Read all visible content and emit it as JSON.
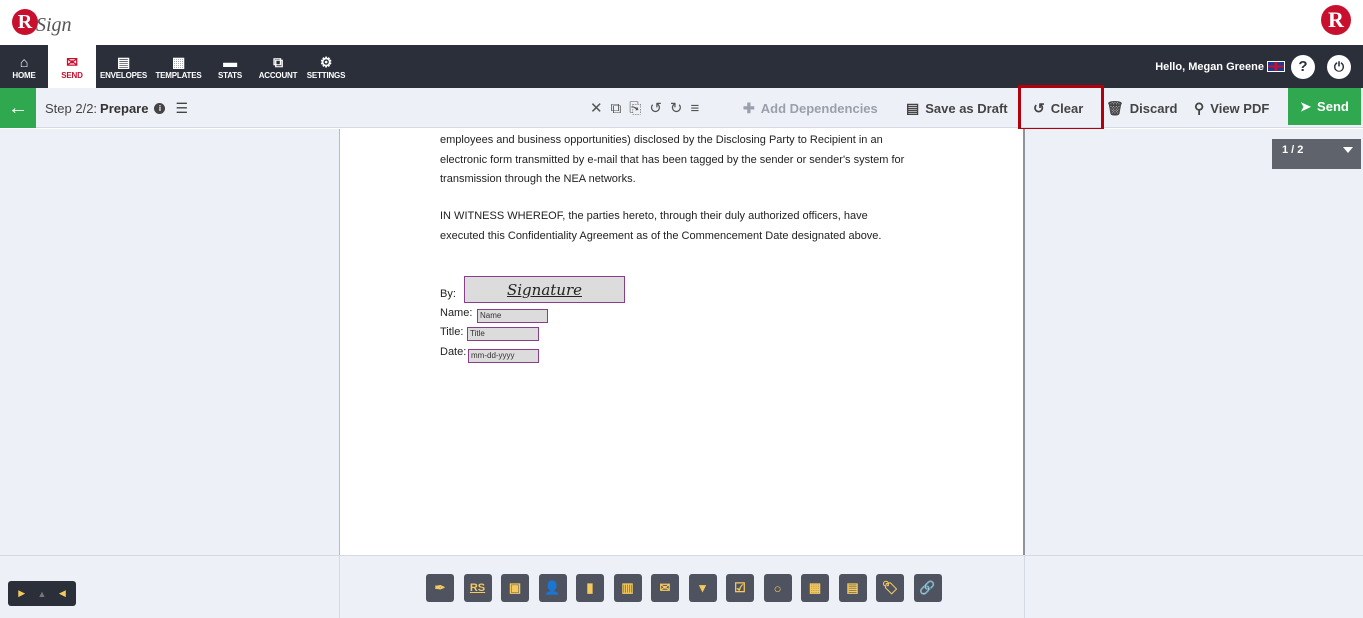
{
  "brand": {
    "logo_letter": "R",
    "logo_text": "Sign"
  },
  "nav": {
    "items": [
      {
        "label": "HOME",
        "icon": "home-icon",
        "glyph": "⌂"
      },
      {
        "label": "SEND",
        "icon": "envelope-icon",
        "glyph": "✉",
        "active": true
      },
      {
        "label": "ENVELOPES",
        "icon": "envelopes-icon",
        "glyph": "▤"
      },
      {
        "label": "TEMPLATES",
        "icon": "templates-icon",
        "glyph": "▦"
      },
      {
        "label": "STATS",
        "icon": "briefcase-icon",
        "glyph": "▬"
      },
      {
        "label": "ACCOUNT",
        "icon": "account-icon",
        "glyph": "⧉"
      },
      {
        "label": "SETTINGS",
        "icon": "gear-icon",
        "glyph": "⚙"
      }
    ],
    "greeting": "Hello, Megan Greene",
    "help_glyph": "?",
    "power_glyph": "⏻"
  },
  "toolbar": {
    "step_prefix": "Step 2/2:",
    "step_name": "Prepare",
    "tool_glyphs": [
      "✕",
      "⧉",
      "⎘",
      "↺",
      "↻",
      "≡"
    ],
    "add_dependencies": "Add Dependencies",
    "save_draft": "Save as Draft",
    "clear": "Clear",
    "discard": "Discard",
    "view_pdf": "View PDF",
    "send": "Send"
  },
  "pager": {
    "label": "1 / 2"
  },
  "document": {
    "para1": [
      "employees and business opportunities) disclosed by the Disclosing Party to Recipient in an",
      "electronic form transmitted by e-mail that has been tagged by the sender or sender's system for",
      "transmission through the NEA networks."
    ],
    "para2": [
      "IN WITNESS WHEREOF, the parties hereto, through their duly authorized officers, have",
      "executed this Confidentiality Agreement as of the Commencement Date designated above."
    ],
    "by_label": "By:",
    "signature_text": "Signature",
    "name_label": "Name:",
    "name_placeholder": "Name",
    "title_label": "Title:",
    "title_placeholder": "Title",
    "date_label": "Date:",
    "date_placeholder": "mm-dd-yyyy"
  },
  "field_tools": [
    {
      "name": "signature-tool",
      "glyph": "✒"
    },
    {
      "name": "initials-tool",
      "glyph": "RS"
    },
    {
      "name": "date-signed-tool",
      "glyph": "▣"
    },
    {
      "name": "name-tool",
      "glyph": "👤"
    },
    {
      "name": "title-tool",
      "glyph": "▮"
    },
    {
      "name": "company-tool",
      "glyph": "▥"
    },
    {
      "name": "email-tool",
      "glyph": "✉"
    },
    {
      "name": "dropdown-tool",
      "glyph": "▾"
    },
    {
      "name": "checkbox-tool",
      "glyph": "☑"
    },
    {
      "name": "radio-tool",
      "glyph": "○"
    },
    {
      "name": "date-tool",
      "glyph": "▦"
    },
    {
      "name": "text-tool",
      "glyph": "▤"
    },
    {
      "name": "label-tool",
      "glyph": "🏷"
    },
    {
      "name": "hyperlink-tool",
      "glyph": "🔗"
    }
  ],
  "nav_ctrl": {
    "next": "▶",
    "up": "▲",
    "prev": "◀"
  }
}
